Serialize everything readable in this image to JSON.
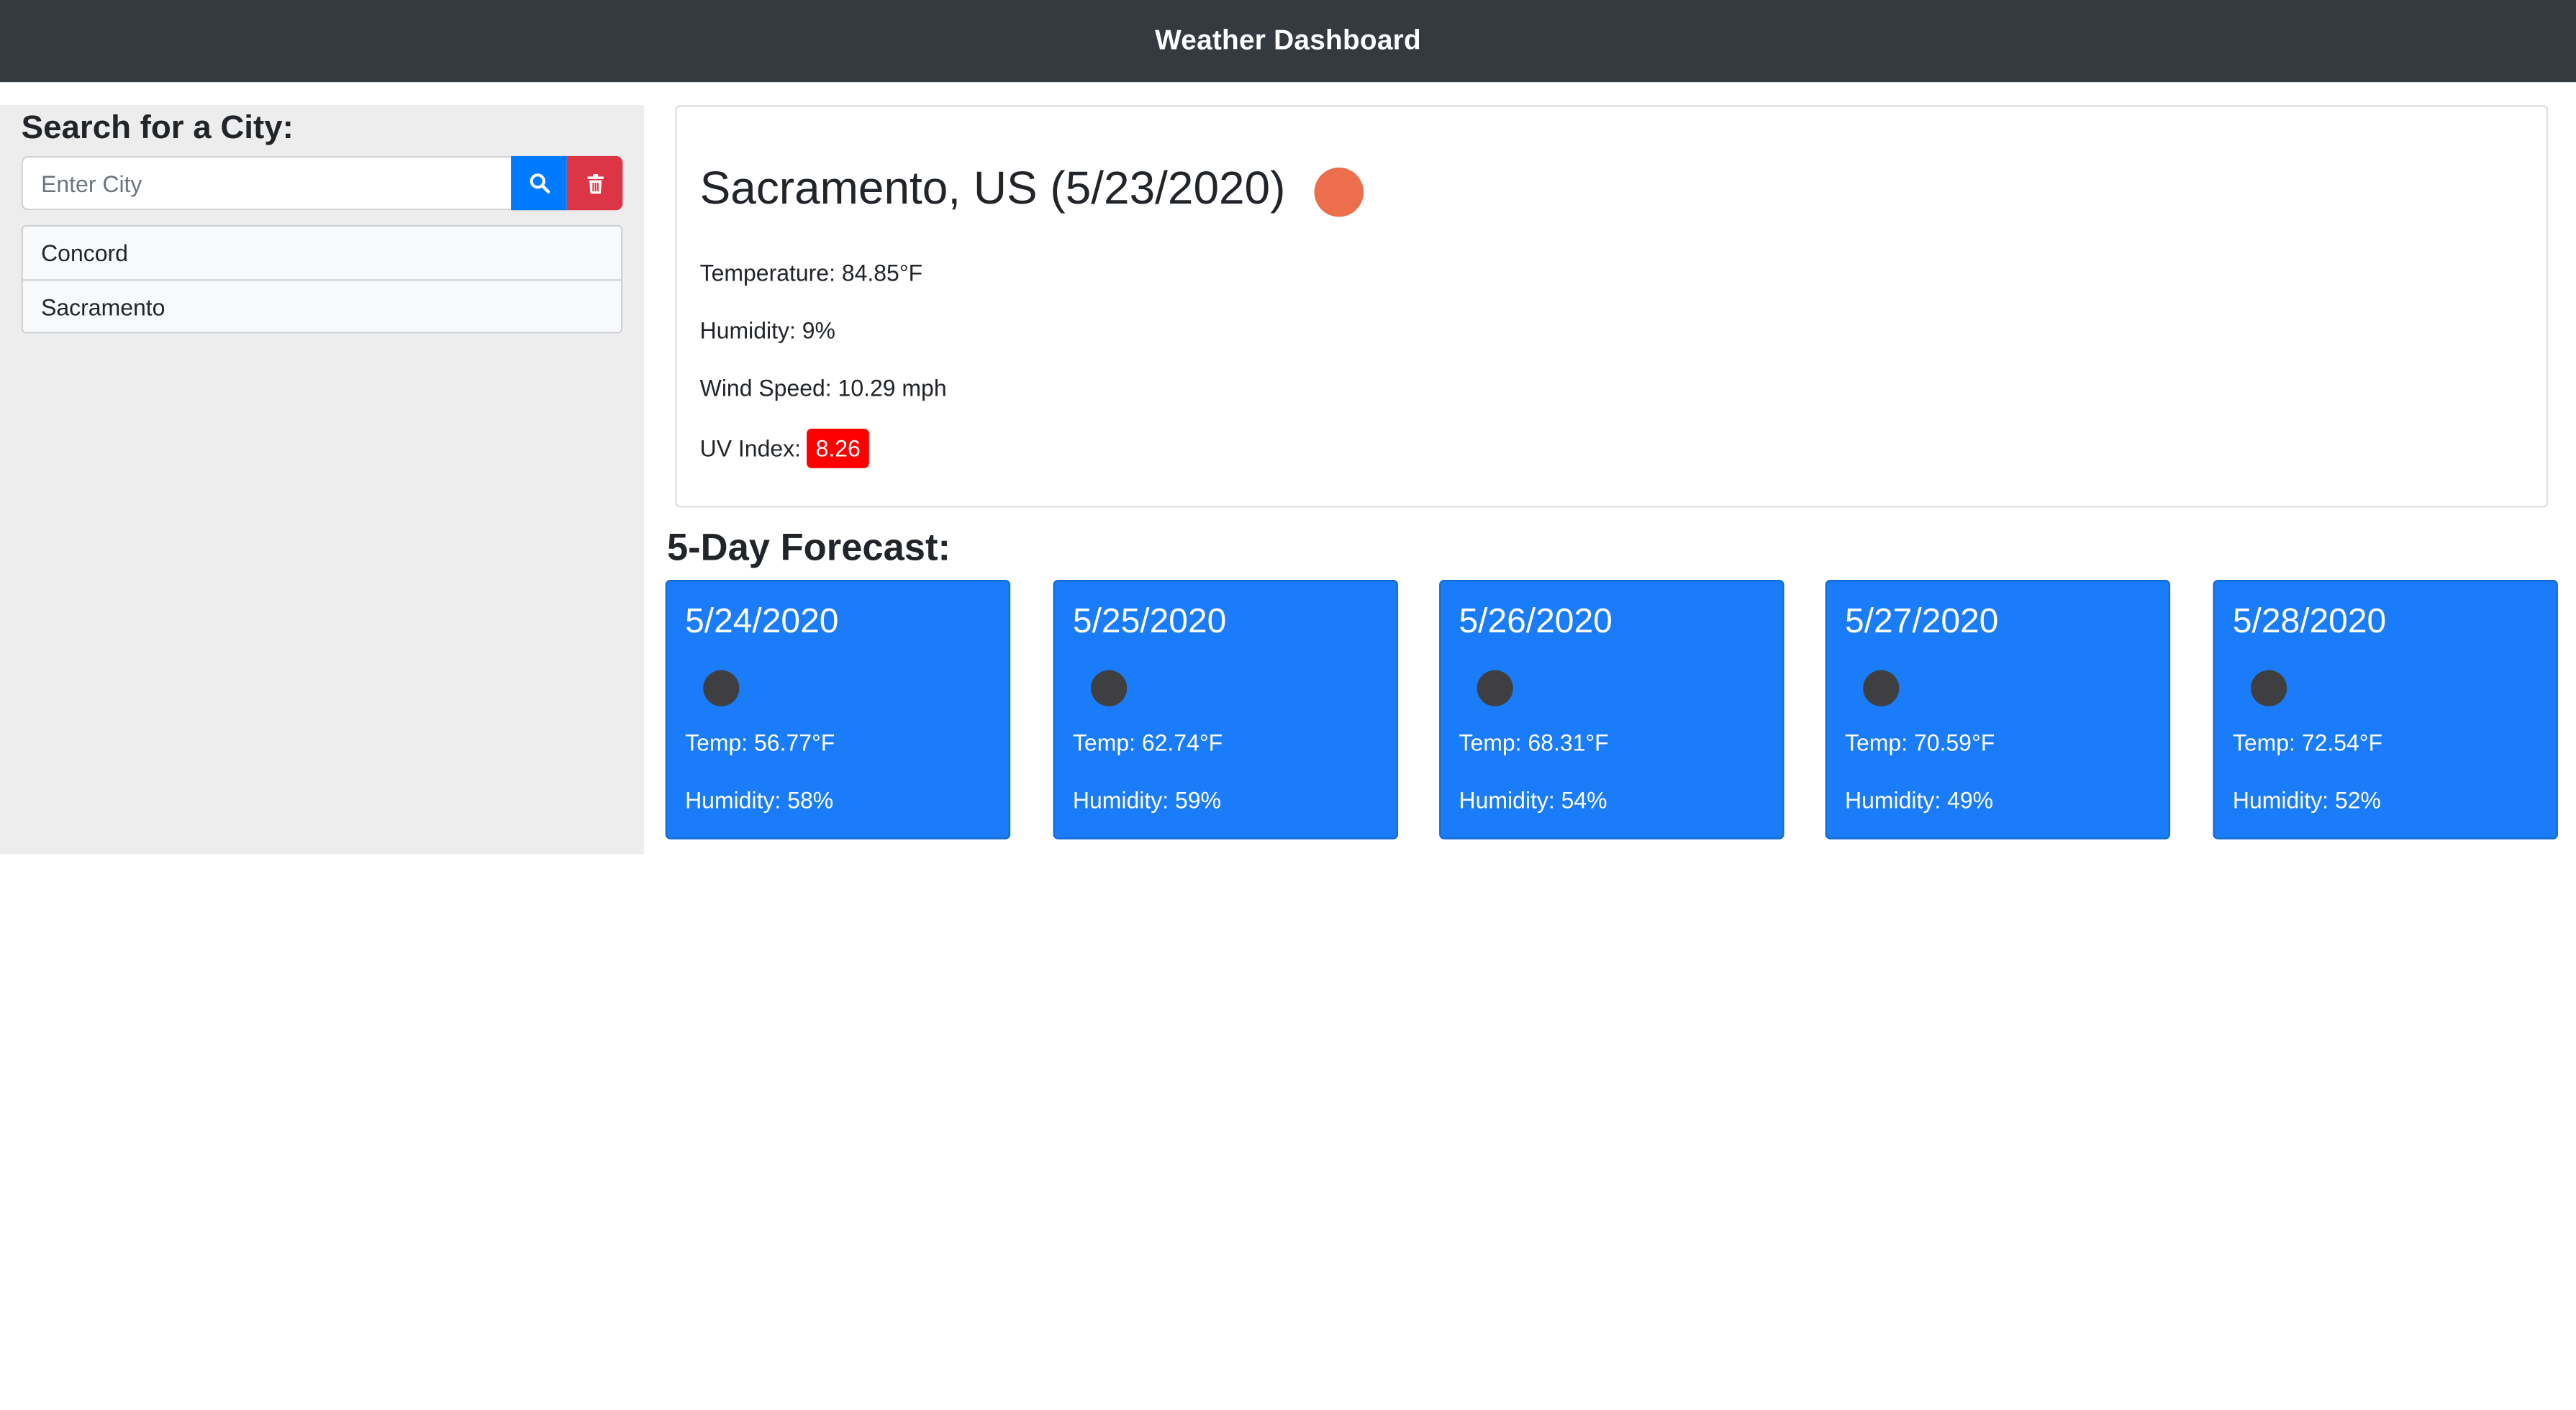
{
  "navbar": {
    "title": "Weather Dashboard"
  },
  "sidebar": {
    "heading": "Search for a City:",
    "search": {
      "placeholder": "Enter City",
      "value": ""
    },
    "icons": {
      "search": "search-icon",
      "clear": "trash-icon"
    },
    "cities": [
      {
        "label": "Concord"
      },
      {
        "label": "Sacramento"
      }
    ]
  },
  "current": {
    "title": "Sacramento, US (5/23/2020)",
    "icon": "sun-icon",
    "icon_color": "#ec6e4c",
    "temperature": "Temperature: 84.85°F",
    "humidity": "Humidity: 9%",
    "wind": "Wind Speed: 10.29 mph",
    "uv_label": "UV Index:",
    "uv_value": "8.26",
    "uv_color": "#ff0000"
  },
  "forecast": {
    "heading": "5-Day Forecast:",
    "card_color": "#1a7cf9",
    "days": [
      {
        "date": "5/24/2020",
        "icon": "weather-icon",
        "temp": "Temp: 56.77°F",
        "humidity": "Humidity: 58%"
      },
      {
        "date": "5/25/2020",
        "icon": "weather-icon",
        "temp": "Temp: 62.74°F",
        "humidity": "Humidity: 59%"
      },
      {
        "date": "5/26/2020",
        "icon": "weather-icon",
        "temp": "Temp: 68.31°F",
        "humidity": "Humidity: 54%"
      },
      {
        "date": "5/27/2020",
        "icon": "weather-icon",
        "temp": "Temp: 70.59°F",
        "humidity": "Humidity: 49%"
      },
      {
        "date": "5/28/2020",
        "icon": "weather-icon",
        "temp": "Temp: 72.54°F",
        "humidity": "Humidity: 52%"
      }
    ]
  }
}
